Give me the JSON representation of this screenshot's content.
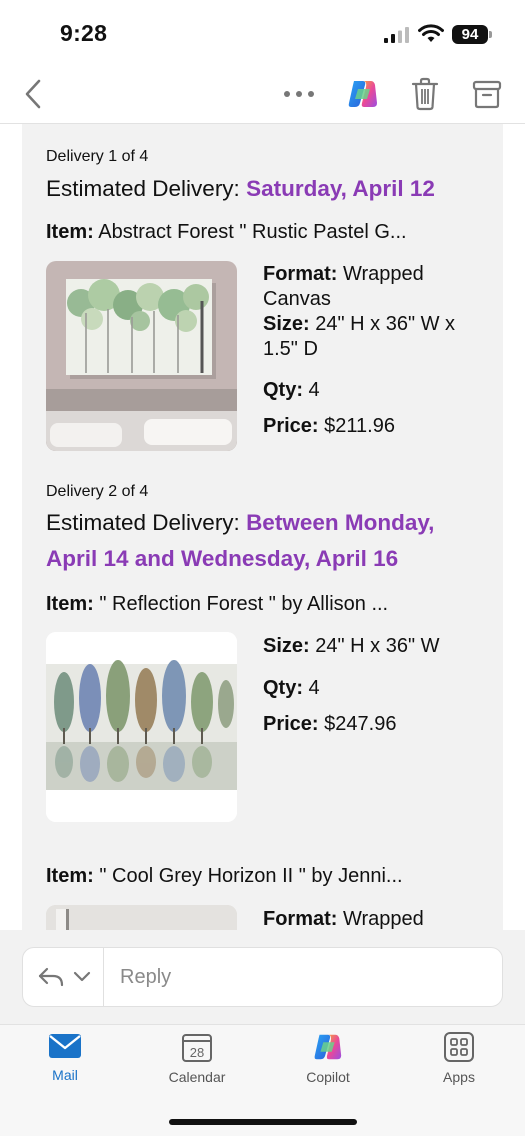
{
  "status_bar": {
    "time": "9:28",
    "battery": "94"
  },
  "toolbar": {
    "back_icon": "chevron-left-icon",
    "more_icon": "ellipsis-icon",
    "copilot_icon": "copilot-icon",
    "delete_icon": "trash-icon",
    "archive_icon": "archive-icon"
  },
  "email": {
    "deliveries": [
      {
        "label": "Delivery 1 of 4",
        "estimated_prefix": "Estimated Delivery: ",
        "estimated_date": "Saturday, April 12",
        "item_prefix": "Item:",
        "item_name": " Abstract Forest \" Rustic Pastel G...",
        "format_label": "Format:",
        "format_value": " Wrapped Canvas",
        "size_label": "Size:",
        "size_value": " 24\" H x 36\" W x 1.5\" D",
        "qty_label": "Qty:",
        "qty_value": " 4",
        "price_label": "Price:",
        "price_value": " $211.96"
      },
      {
        "label": "Delivery 2 of 4",
        "estimated_prefix": "Estimated Delivery: ",
        "estimated_date": "Between Monday, April 14 and Wednesday, April 16",
        "item_prefix": "Item:",
        "item_name": " \" Reflection Forest \" by Allison ...",
        "size_label": "Size:",
        "size_value": " 24\" H x 36\" W",
        "qty_label": "Qty:",
        "qty_value": " 4",
        "price_label": "Price:",
        "price_value": " $247.96"
      }
    ],
    "third_item": {
      "item_prefix": "Item:",
      "item_name": " \" Cool Grey Horizon II \" by Jenni...",
      "format_label": "Format:",
      "format_value": " Wrapped"
    }
  },
  "reply": {
    "placeholder": "Reply",
    "reply_icon": "reply-icon",
    "chevron_icon": "chevron-down-icon"
  },
  "tabs": [
    {
      "label": "Mail",
      "icon": "mail-icon",
      "active": true
    },
    {
      "label": "Calendar",
      "icon": "calendar-icon",
      "day": "28",
      "active": false
    },
    {
      "label": "Copilot",
      "icon": "copilot-icon",
      "active": false
    },
    {
      "label": "Apps",
      "icon": "apps-icon",
      "active": false
    }
  ],
  "colors": {
    "accent_purple": "#8a3bb5",
    "tab_active": "#1a73c8",
    "background_panel": "#f2f2f2"
  }
}
